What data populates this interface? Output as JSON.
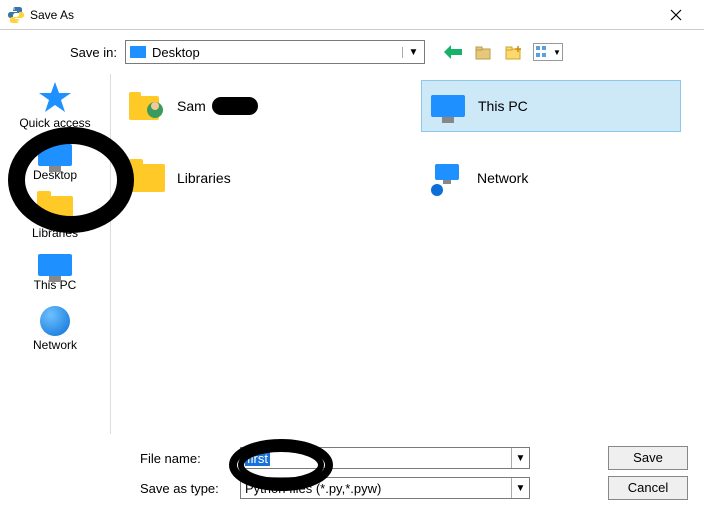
{
  "window": {
    "title": "Save As"
  },
  "saveIn": {
    "label": "Save in:",
    "value": "Desktop"
  },
  "toolbar": {
    "back": "back-icon",
    "up": "up-folder-icon",
    "newFolder": "new-folder-icon",
    "viewMenu": "view-menu-icon"
  },
  "sidebar": {
    "items": [
      {
        "label": "Quick access"
      },
      {
        "label": "Desktop"
      },
      {
        "label": "Libraries"
      },
      {
        "label": "This PC"
      },
      {
        "label": "Network"
      }
    ]
  },
  "listing": {
    "items": [
      {
        "label": "Sam"
      },
      {
        "label": "This PC",
        "selected": true
      },
      {
        "label": "Libraries"
      },
      {
        "label": "Network"
      }
    ]
  },
  "fileName": {
    "label": "File name:",
    "value": "first"
  },
  "saveType": {
    "label": "Save as type:",
    "value": "Python files (*.py,*.pyw)"
  },
  "buttons": {
    "save": "Save",
    "cancel": "Cancel"
  }
}
